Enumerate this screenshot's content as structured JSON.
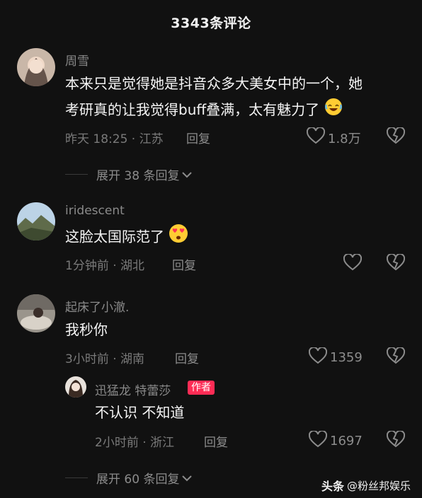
{
  "header": {
    "title": "3343条评论"
  },
  "comments": [
    {
      "username": "周雪",
      "text_line1": "本来只是觉得她是抖音众多大美女中的一个，她",
      "text_line2": "考研真的让我觉得buff叠满，太有魅力了",
      "meta": "昨天 18:25 · 江苏",
      "reply": "回复",
      "likes": "1.8万",
      "expand": "展开 38 条回复"
    },
    {
      "username": "iridescent",
      "text": "这脸太国际范了",
      "meta": "1分钟前 · 湖北",
      "reply": "回复",
      "likes": ""
    },
    {
      "username": "起床了小澈.",
      "text": "我秒你",
      "meta": "3小时前 · 湖南",
      "reply": "回复",
      "likes": "1359"
    }
  ],
  "subreply": {
    "username": "迅猛龙 特蕾莎",
    "badge": "作者",
    "text": "不认识 不知道",
    "meta": "2小时前 · 浙江",
    "reply": "回复",
    "likes": "1697"
  },
  "expand2": "展开 60 条回复",
  "watermark": {
    "brand": "头条",
    "handle": "@粉丝邦娱乐"
  },
  "colors": {
    "background": "#111111",
    "badge": "#fe2c55",
    "muted": "#8c8c8c"
  }
}
